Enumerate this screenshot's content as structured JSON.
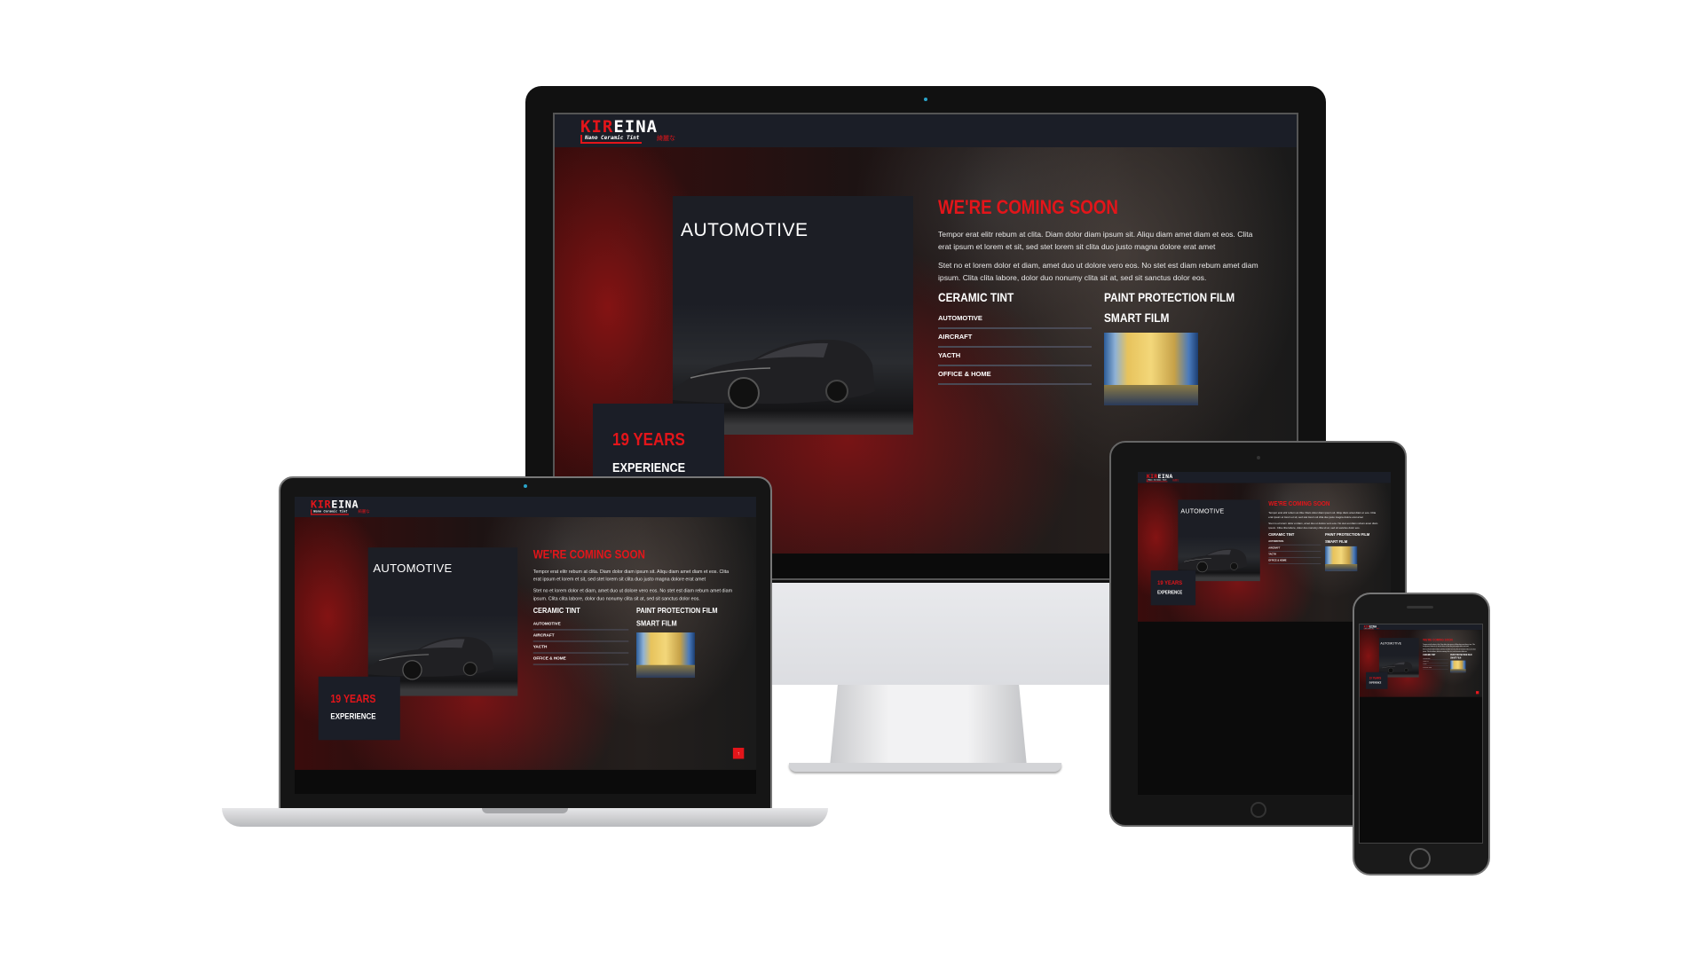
{
  "site": {
    "logo": {
      "part_red": "KIR",
      "part_white": "EINA",
      "tagline": "Nano Ceramic Tint",
      "japanese": "綺麗な"
    },
    "service_box": {
      "title": "AUTOMOTIVE"
    },
    "experience": {
      "years": "19 YEARS",
      "label": "EXPERIENCE"
    },
    "hero": {
      "title": "WE'RE COMING SOON",
      "paragraph_1": "Tempor erat elitr rebum at clita. Diam dolor diam ipsum sit. Aliqu diam amet diam et eos. Clita erat ipsum et lorem et sit, sed stet lorem sit clita duo justo magna dolore erat amet",
      "paragraph_2": "Stet no et lorem dolor et diam, amet duo ut dolore vero eos. No stet est diam rebum amet diam ipsum. Clita clita labore, dolor duo nonumy clita sit at, sed sit sanctus dolor eos."
    },
    "ceramic_tint": {
      "heading": "CERAMIC TINT",
      "items": [
        "AUTOMOTIVE",
        "AIRCRAFT",
        "YACTH",
        "OFFICE & HOME"
      ]
    },
    "paint_protection_film": {
      "heading": "PAINT PROTECTION FILM"
    },
    "smart_film": {
      "heading": "SMART FILM"
    },
    "back_to_top": {
      "icon": "arrow-up-icon",
      "glyph": "↑"
    },
    "colors": {
      "accent": "#e3151a",
      "header_bg": "#1b1e27"
    }
  }
}
